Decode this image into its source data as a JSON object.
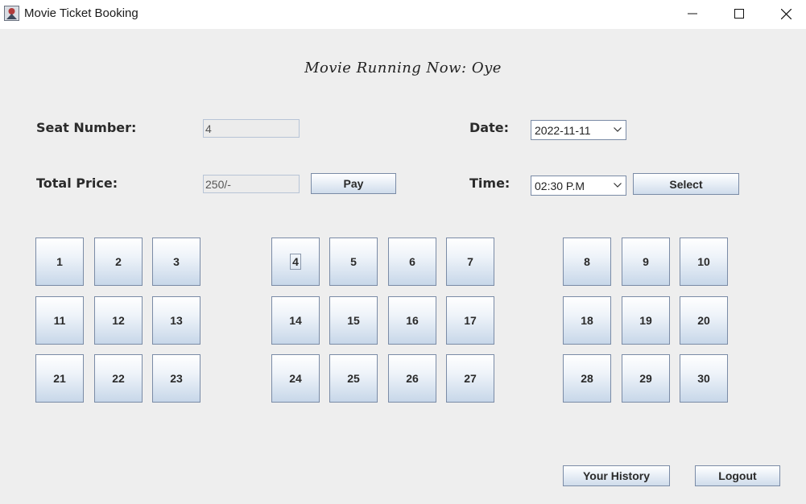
{
  "window": {
    "title": "Movie Ticket Booking",
    "controls": [
      "minimize",
      "maximize",
      "close"
    ]
  },
  "heading": "Movie Running Now: Oye",
  "form": {
    "seat_label": "Seat Number:",
    "seat_value": "4",
    "price_label": "Total Price:",
    "price_value": "250/-",
    "pay_label": "Pay",
    "date_label": "Date:",
    "date_value": "2022-11-11",
    "time_label": "Time:",
    "time_value": "02:30 P.M",
    "select_label": "Select"
  },
  "seats": [
    "1",
    "2",
    "3",
    "4",
    "5",
    "6",
    "7",
    "8",
    "9",
    "10",
    "11",
    "12",
    "13",
    "14",
    "15",
    "16",
    "17",
    "18",
    "19",
    "20",
    "21",
    "22",
    "23",
    "24",
    "25",
    "26",
    "27",
    "28",
    "29",
    "30"
  ],
  "selected_seat": "4",
  "footer": {
    "history_label": "Your History",
    "logout_label": "Logout"
  },
  "colors": {
    "background": "#eeeeee",
    "button_border": "#7a8ba6",
    "button_gradient_bottom": "#c7d7e9"
  }
}
